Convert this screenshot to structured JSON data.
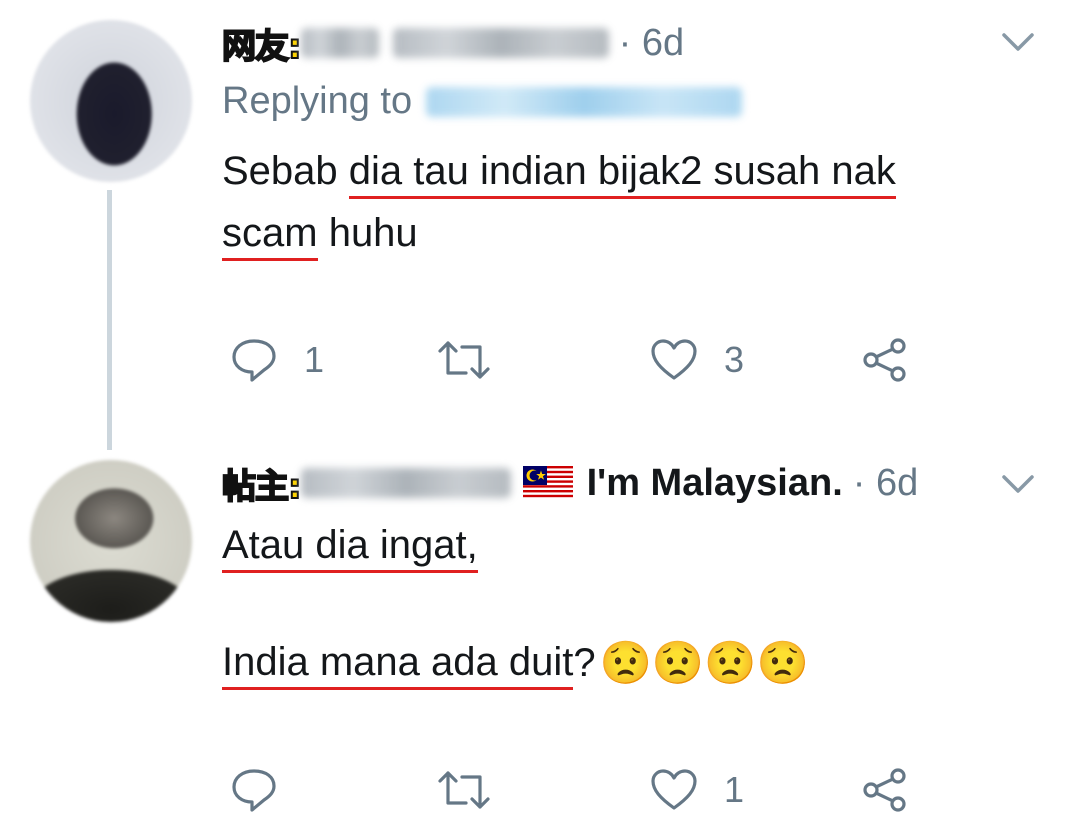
{
  "tweets": [
    {
      "tag": "网友:",
      "time": "· 6d",
      "replying_label": "Replying to",
      "line1_underlined": "dia tau indian bijak2 susah nak",
      "line1_prefix": "Sebab ",
      "line2_underlined": "scam",
      "line2_suffix": " huhu",
      "reply_count": "1",
      "retweet_count": "",
      "like_count": "3"
    },
    {
      "tag": "帖主:",
      "display_suffix": "I'm Malaysian.",
      "time": "· 6d",
      "line1_underlined": "Atau dia ingat,",
      "line2_underlined": "India mana ada duit",
      "line2_suffix": "?",
      "emojis": "😟😟😟😟",
      "reply_count": "",
      "retweet_count": "",
      "like_count": "1"
    }
  ],
  "colors": {
    "text": "#14171a",
    "muted": "#657786",
    "underline": "#e02020",
    "tag_fill": "#ffd400",
    "thread_line": "#ccd6dd"
  },
  "icons": [
    "chevron-down-icon",
    "reply-icon",
    "retweet-icon",
    "like-icon",
    "share-icon",
    "malaysia-flag-icon"
  ]
}
